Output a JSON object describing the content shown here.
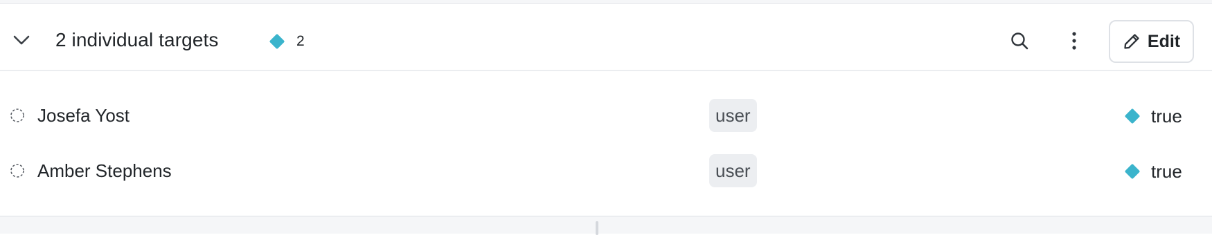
{
  "header": {
    "title": "2 individual targets",
    "variation_count": "2",
    "variation_color": "#3bb4cc",
    "edit_label": "Edit",
    "icons": [
      "chevron-down-icon",
      "diamond-icon",
      "search-icon",
      "more-vertical-icon",
      "pencil-icon"
    ]
  },
  "targets": [
    {
      "name": "Josefa Yost",
      "kind": "user",
      "variation": "true",
      "status_icon": "dashed-circle-icon"
    },
    {
      "name": "Amber Stephens",
      "kind": "user",
      "variation": "true",
      "status_icon": "dashed-circle-icon"
    }
  ]
}
